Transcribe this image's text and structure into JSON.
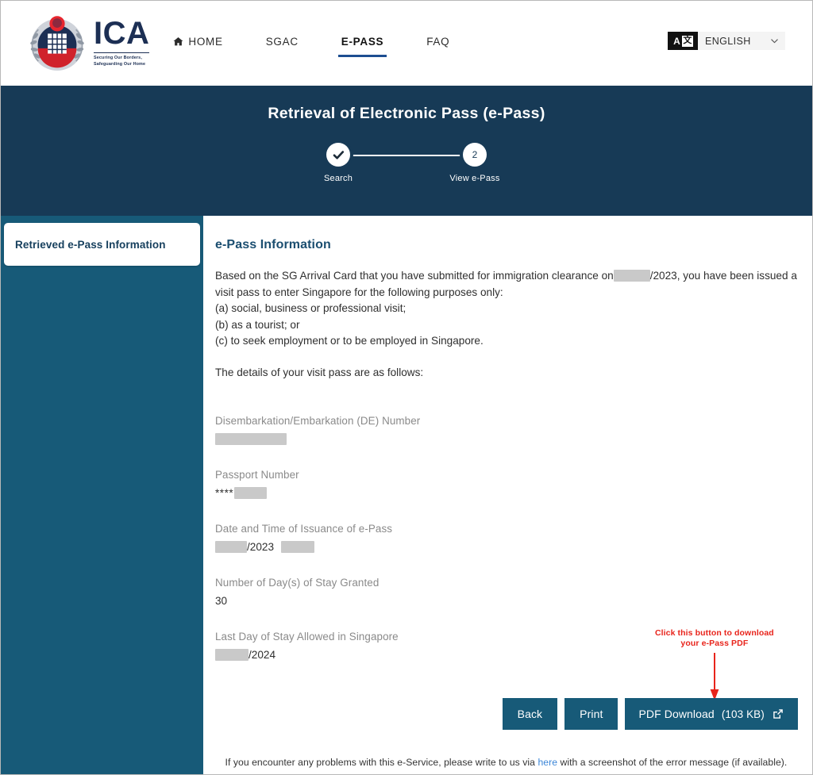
{
  "header": {
    "logo": {
      "acronym": "ICA",
      "tagline_line1": "Securing Our Borders,",
      "tagline_line2": "Safeguarding Our Home",
      "crest_icon": "ica-crest-icon"
    },
    "nav": [
      {
        "label": "HOME",
        "icon": "home-icon",
        "active": false
      },
      {
        "label": "SGAC",
        "icon": "",
        "active": false
      },
      {
        "label": "E-PASS",
        "icon": "",
        "active": true
      },
      {
        "label": "FAQ",
        "icon": "",
        "active": false
      }
    ],
    "language": {
      "icon": "translate-icon",
      "icon_left_glyph": "A",
      "icon_right_glyph": "文",
      "selected": "ENGLISH",
      "chevron_icon": "chevron-down-icon"
    }
  },
  "banner": {
    "title": "Retrieval of Electronic Pass (e-Pass)",
    "steps": [
      {
        "label": "Search",
        "marker": "check",
        "icon": "check-icon",
        "state": "completed"
      },
      {
        "label": "View e-Pass",
        "marker": "2",
        "icon": "",
        "state": "current"
      }
    ]
  },
  "sidebar": {
    "items": [
      {
        "label": "Retrieved e-Pass Information",
        "active": true
      }
    ]
  },
  "main": {
    "title": "e-Pass Information",
    "intro": {
      "line1_before": "Based on the SG Arrival Card that you have submitted for immigration clearance on",
      "line1_redacted": true,
      "line1_after": "/2023, you have been issued a",
      "line2": "visit pass to enter Singapore for the following purposes only:",
      "line3": "(a) social, business or professional visit;",
      "line4": "(b) as a tourist; or",
      "line5": "(c) to seek employment or to be employed in Singapore."
    },
    "details_lead": "The details of your visit pass are as follows:",
    "fields": [
      {
        "label": "Disembarkation/Embarkation (DE) Number",
        "value": "",
        "redacted": true
      },
      {
        "label": "Passport Number",
        "value": "****",
        "redacted": true
      },
      {
        "label": "Date and Time of Issuance of e-Pass",
        "value": "/2023",
        "redacted": true
      },
      {
        "label": "Number of Day(s) of Stay Granted",
        "value": "30",
        "redacted": false
      },
      {
        "label": "Last Day of Stay Allowed in Singapore",
        "value": "/2024",
        "redacted": true
      }
    ],
    "annotation": {
      "line1": "Click this button to download",
      "line2": "your e-Pass PDF",
      "arrow_icon": "down-arrow-icon",
      "color": "#e8241b"
    },
    "buttons": {
      "back": "Back",
      "print": "Print",
      "pdf_download": "PDF Download",
      "pdf_size": "(103 KB)",
      "pdf_icon": "external-link-icon"
    },
    "footer": {
      "before_link": "If you encounter any problems with this e-Service, please write to us via",
      "link": "here",
      "after_link": "with a screenshot of the error message (if available)."
    }
  },
  "colors": {
    "banner_navy": "#173a56",
    "sidebar_teal": "#175a78",
    "button_teal": "#175a78",
    "heading_blue": "#1b4e70",
    "link_blue": "#3b86d8",
    "annotation_red": "#e8241b",
    "nav_underline": "#1d4e91",
    "redaction_gray": "#c9c9c9"
  }
}
